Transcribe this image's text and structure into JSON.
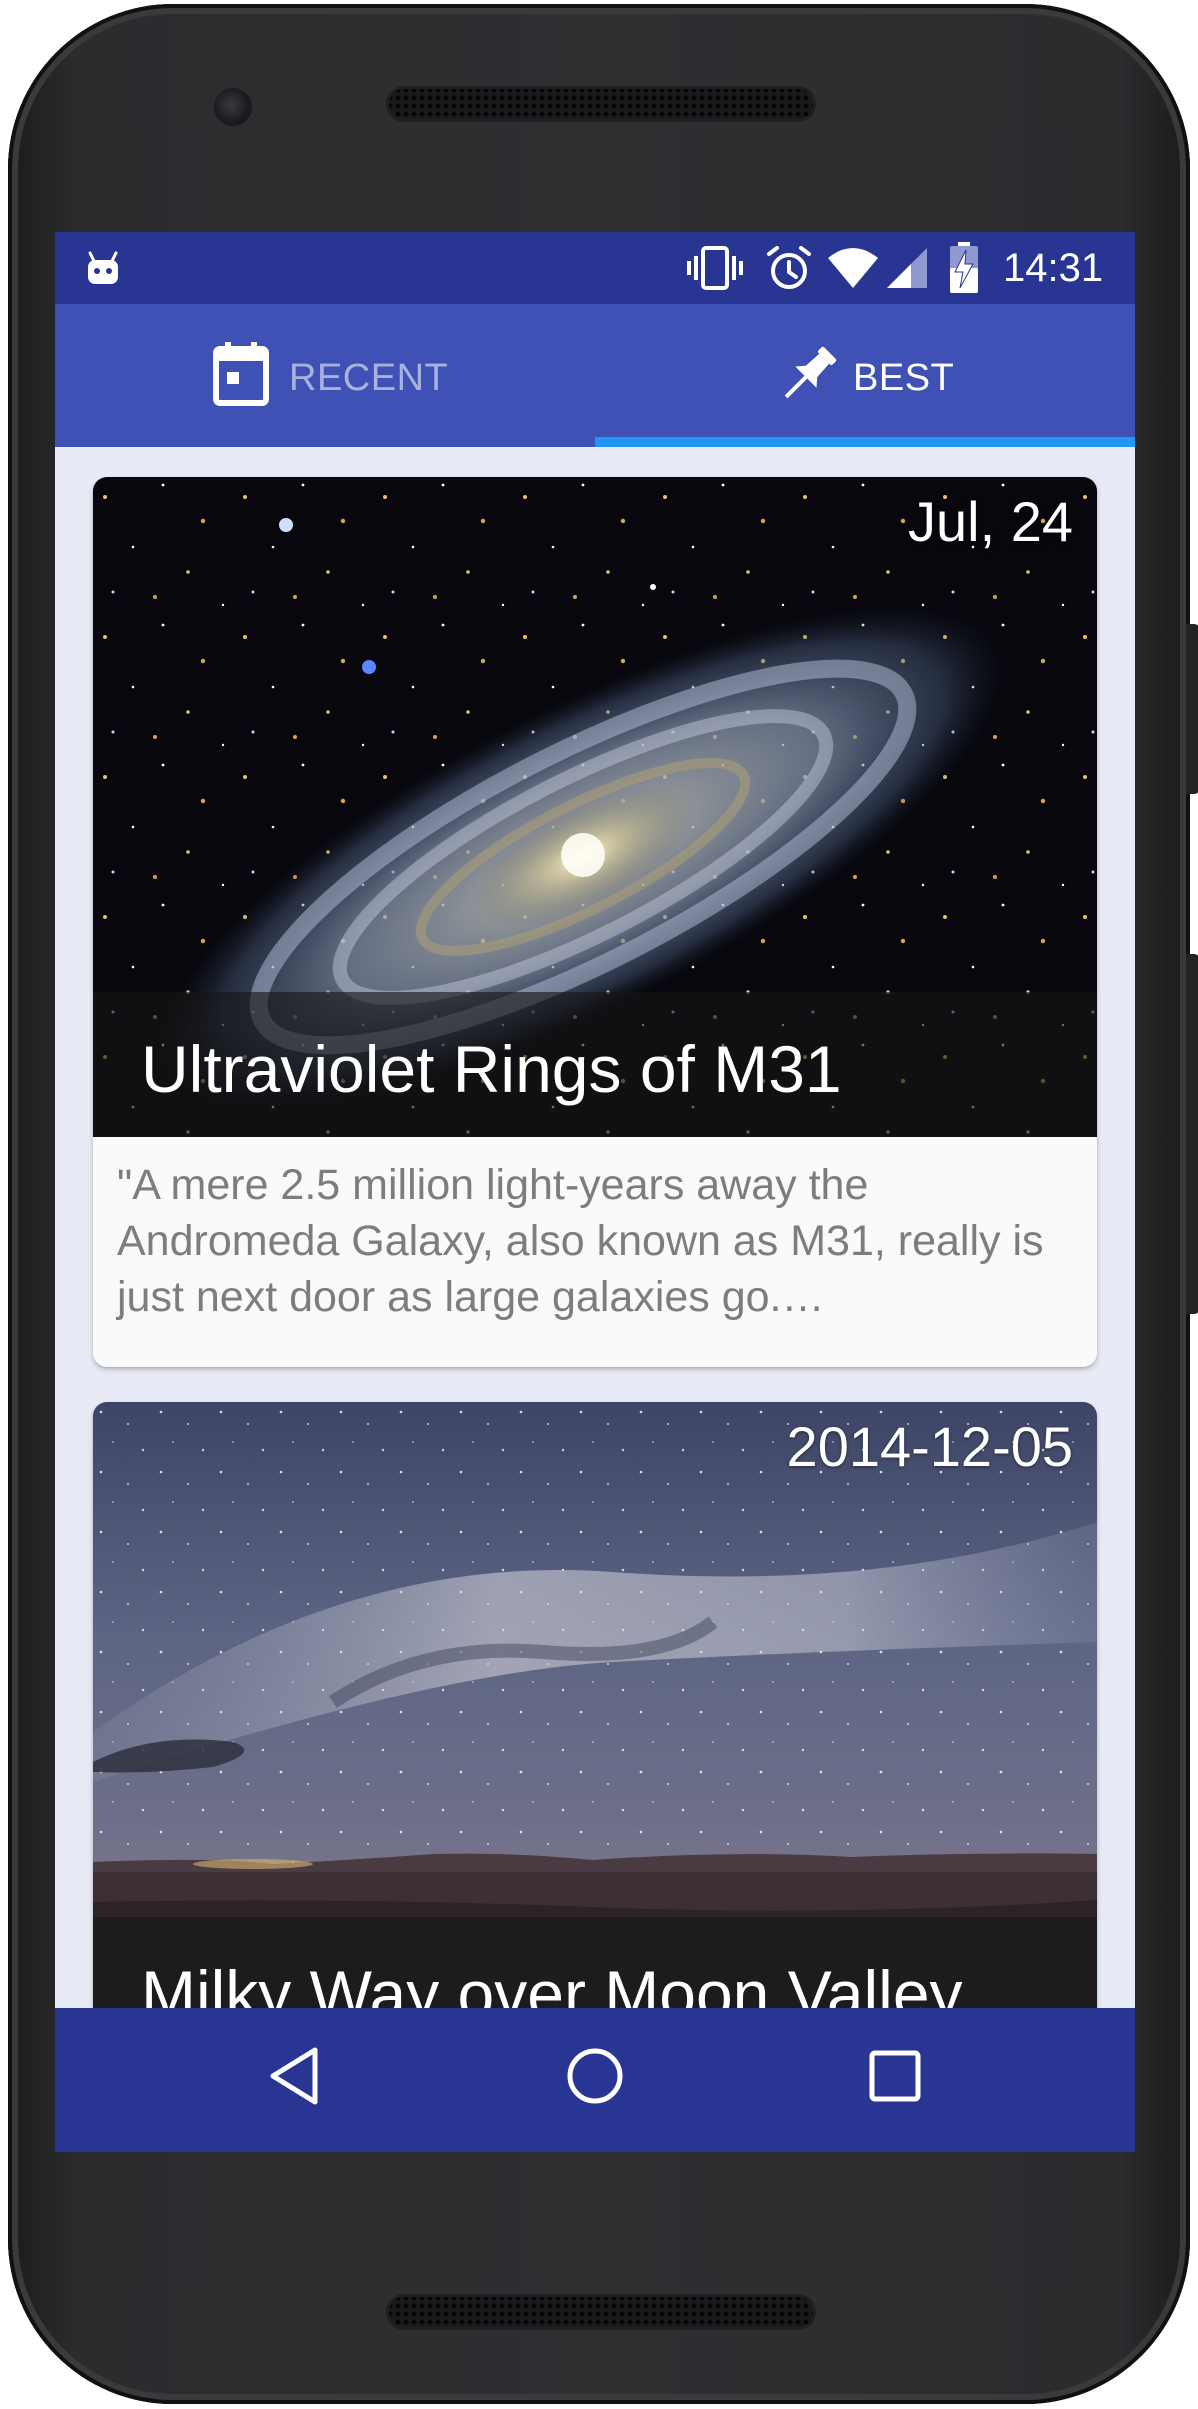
{
  "status_bar": {
    "time": "14:31",
    "icons": [
      "android-debug-icon",
      "vibrate-icon",
      "alarm-icon",
      "wifi-icon",
      "signal-icon",
      "battery-charging-icon"
    ]
  },
  "tabs": [
    {
      "label": "RECENT",
      "icon": "calendar-icon",
      "selected": false
    },
    {
      "label": "BEST",
      "icon": "pin-icon",
      "selected": true
    }
  ],
  "cards": [
    {
      "date": "Jul, 24",
      "title": "Ultraviolet Rings of M31",
      "description": "\"A mere 2.5 million light-years away the Andromeda Galaxy, also known as M31, really is just next door as large galaxies go.…"
    },
    {
      "date": "2014-12-05",
      "title": "Milky Way over Moon Valley"
    }
  ],
  "nav_bar": {
    "buttons": [
      "back-icon",
      "home-icon",
      "recents-icon"
    ]
  },
  "colors": {
    "primary_dark": "#283593",
    "primary": "#3f51b5",
    "accent": "#2196f3",
    "background": "#e8eaf6"
  }
}
